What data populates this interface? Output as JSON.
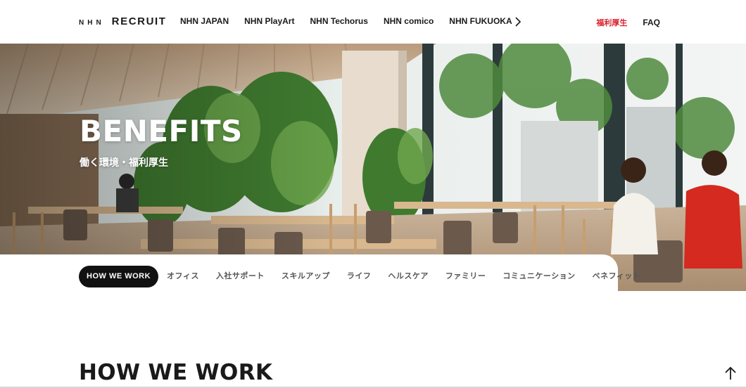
{
  "header": {
    "logo_prefix": "NHN",
    "logo_main": "RECRUIT",
    "nav": [
      {
        "label": "NHN JAPAN"
      },
      {
        "label": "NHN PlayArt"
      },
      {
        "label": "NHN Techorus"
      },
      {
        "label": "NHN comico"
      },
      {
        "label": "NHN FUKUOKA"
      }
    ],
    "next_icon": "chevron-right-icon",
    "benefits_label": "福利厚生",
    "faq_label": "FAQ",
    "benefits_color": "#d8202a"
  },
  "hero": {
    "title": "BENEFITS",
    "subtitle": "働く環境・福利厚生"
  },
  "tabs": [
    {
      "label": "HOW WE WORK",
      "active": true
    },
    {
      "label": "オフィス"
    },
    {
      "label": "入社サポート"
    },
    {
      "label": "スキルアップ"
    },
    {
      "label": "ライフ"
    },
    {
      "label": "ヘルスケア"
    },
    {
      "label": "ファミリー"
    },
    {
      "label": "コミュニケーション"
    },
    {
      "label": "ベネフィット"
    }
  ],
  "main": {
    "section_title": "HOW WE WORK"
  },
  "back_to_top_icon": "arrow-up-icon"
}
